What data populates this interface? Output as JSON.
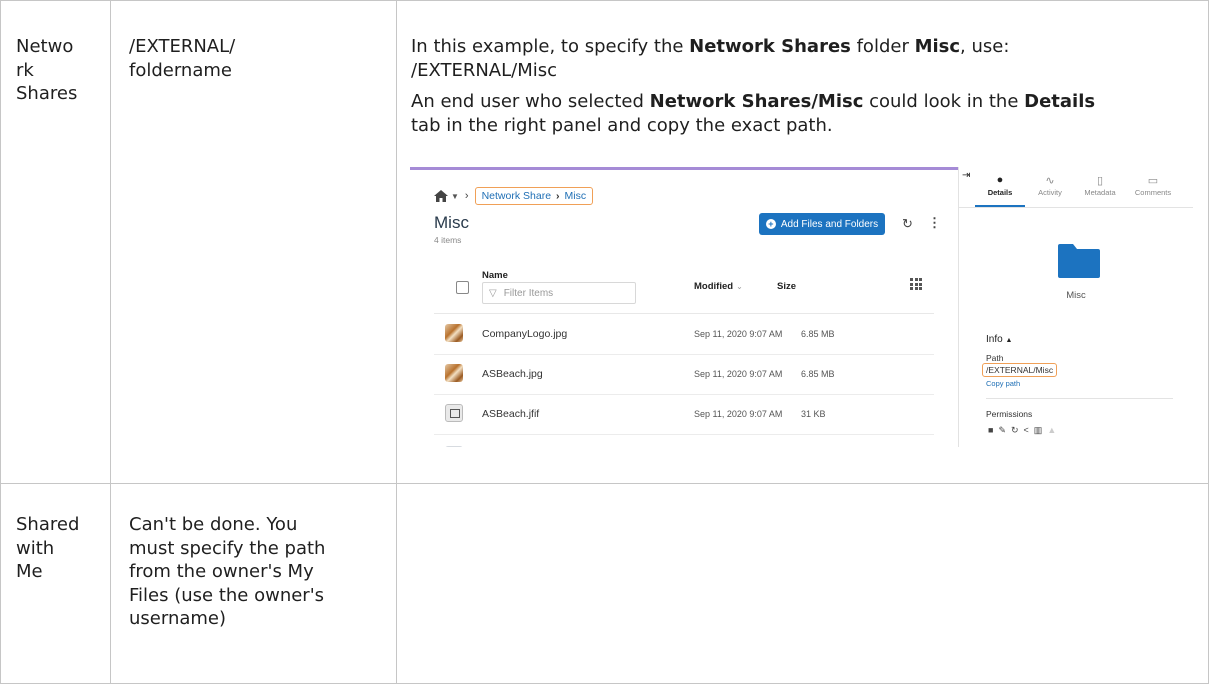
{
  "rows": [
    {
      "location": "Network Shares",
      "location_lines": [
        "Netwo",
        "rk",
        "Shares"
      ],
      "path_lines": [
        "/EXTERNAL/",
        "foldername"
      ],
      "desc": {
        "p1_pre": "In this example, to specify the ",
        "p1_b1": "Network Shares",
        "p1_mid": " folder ",
        "p1_b2": "Misc",
        "p1_post": ", use:",
        "p1_line2": "/EXTERNAL/Misc",
        "p2_pre": "An end user who selected ",
        "p2_b1": "Network Shares/Misc",
        "p2_mid": " could look in the ",
        "p2_b2": "Details",
        "p2_post": "tab in the right panel and copy the exact path."
      }
    },
    {
      "location": "Shared with Me",
      "location_lines": [
        "Shared",
        "with",
        "Me"
      ],
      "path_lines": [
        "Can't be done. You",
        "must specify the path",
        "from the owner's My",
        "Files (use the owner's",
        "username)"
      ]
    }
  ],
  "screenshot": {
    "breadcrumb": {
      "item1": "Network Share",
      "item2": "Misc"
    },
    "folder_title": "Misc",
    "item_count": "4 items",
    "add_button": "Add Files and Folders",
    "columns": {
      "name": "Name",
      "filter_placeholder": "Filter Items",
      "modified": "Modified",
      "size": "Size"
    },
    "files": [
      {
        "name": "CompanyLogo.jpg",
        "modified": "Sep 11, 2020 9:07 AM",
        "size": "6.85 MB",
        "icon": "image-thumbnail"
      },
      {
        "name": "ASBeach.jpg",
        "modified": "Sep 11, 2020 9:07 AM",
        "size": "6.85 MB",
        "icon": "image-thumbnail"
      },
      {
        "name": "ASBeach.jfif",
        "modified": "Sep 11, 2020 9:07 AM",
        "size": "31 KB",
        "icon": "generic-image-file-icon"
      }
    ],
    "panel": {
      "tabs": [
        "Details",
        "Activity",
        "Metadata",
        "Comments"
      ],
      "active_tab": "Details",
      "folder_name": "Misc",
      "info_label": "Info",
      "path_label": "Path",
      "path_value": "/EXTERNAL/Misc",
      "copy_path": "Copy path",
      "permissions_label": "Permissions"
    },
    "colors": {
      "accent": "#1c73c0",
      "highlight_box": "#f0a057",
      "top_bar": "#a58bd6",
      "folder": "#1c73c0"
    }
  }
}
